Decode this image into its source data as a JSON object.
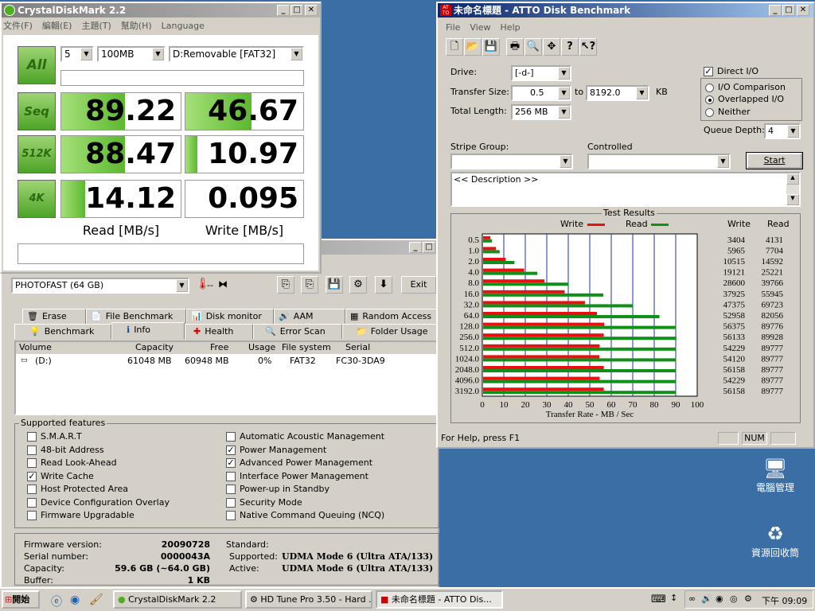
{
  "cdm": {
    "title": "CrystalDiskMark 2.2",
    "menu": [
      "文件(F)",
      "編輯(E)",
      "主題(T)",
      "幫助(H)",
      "Language"
    ],
    "count": "5",
    "size": "100MB",
    "drive": "D:Removable [FAT32]",
    "all_label": "All",
    "rows": [
      {
        "label": "Seq",
        "read": "89.22",
        "write": "46.67",
        "read_fill": 0.53,
        "write_fill": 0.56
      },
      {
        "label": "512K",
        "read": "88.47",
        "write": "10.97",
        "read_fill": 0.53,
        "write_fill": 0.1
      },
      {
        "label": "4K",
        "read": "14.12",
        "write": "0.095",
        "read_fill": 0.2,
        "write_fill": 0.0
      }
    ],
    "read_label": "Read [MB/s]",
    "write_label": "Write [MB/s]"
  },
  "hdtune": {
    "device": "PHOTOFAST (64 GB)",
    "temp": "-- ",
    "exit_label": "Exit",
    "tabs_top": [
      {
        "icon": "🗑",
        "label": "Erase"
      },
      {
        "icon": "📄",
        "label": "File Benchmark"
      },
      {
        "icon": "📊",
        "label": "Disk monitor"
      },
      {
        "icon": "🔊",
        "label": "AAM"
      },
      {
        "icon": "▦",
        "label": "Random Access"
      }
    ],
    "tabs_bottom": [
      {
        "icon": "💡",
        "label": "Benchmark"
      },
      {
        "icon": "ℹ",
        "label": "Info"
      },
      {
        "icon": "✚",
        "label": "Health"
      },
      {
        "icon": "🔍",
        "label": "Error Scan"
      },
      {
        "icon": "📁",
        "label": "Folder Usage"
      }
    ],
    "columns": [
      "Volume",
      "Capacity",
      "Free",
      "Usage",
      "File system",
      "Serial"
    ],
    "volume": {
      "name": "(D:)",
      "capacity": "61048 MB",
      "free": "60948 MB",
      "usage": "0%",
      "fs": "FAT32",
      "serial": "FC30-3DA9"
    },
    "features_label": "Supported features",
    "features_left": [
      {
        "label": "S.M.A.R.T",
        "checked": false
      },
      {
        "label": "48-bit Address",
        "checked": false
      },
      {
        "label": "Read Look-Ahead",
        "checked": false
      },
      {
        "label": "Write Cache",
        "checked": true
      },
      {
        "label": "Host Protected Area",
        "checked": false
      },
      {
        "label": "Device Configuration Overlay",
        "checked": false
      },
      {
        "label": "Firmware Upgradable",
        "checked": false
      }
    ],
    "features_right": [
      {
        "label": "Automatic Acoustic Management",
        "checked": false
      },
      {
        "label": "Power Management",
        "checked": true
      },
      {
        "label": "Advanced Power Management",
        "checked": true
      },
      {
        "label": "Interface Power Management",
        "checked": false
      },
      {
        "label": "Power-up in Standby",
        "checked": false
      },
      {
        "label": "Security Mode",
        "checked": false
      },
      {
        "label": "Native Command Queuing (NCQ)",
        "checked": false
      }
    ],
    "info": {
      "firmware_label": "Firmware version:",
      "firmware": "20090728",
      "serial_label": "Serial number:",
      "serial": "0000043A",
      "capacity_label": "Capacity:",
      "capacity": "59.6 GB (~64.0 GB)",
      "buffer_label": "Buffer:",
      "buffer": "1 KB",
      "standard_label": "Standard:",
      "supported_label": "Supported:",
      "supported": "UDMA Mode 6 (Ultra ATA/133)",
      "active_label": "Active:",
      "active": "UDMA Mode 6 (Ultra ATA/133)"
    }
  },
  "atto": {
    "title": "未命名標題 - ATTO Disk Benchmark",
    "menu": [
      "File",
      "View",
      "Help"
    ],
    "drive_label": "Drive:",
    "drive": "[-d-]",
    "transfer_label": "Transfer Size:",
    "transfer_from": "0.5",
    "to_label": "to",
    "transfer_to": "8192.0",
    "kb_label": "KB",
    "total_label": "Total Length:",
    "total": "256 MB",
    "direct_io": "Direct I/O",
    "radios": [
      {
        "label": "I/O Comparison",
        "on": false
      },
      {
        "label": "Overlapped I/O",
        "on": true
      },
      {
        "label": "Neither",
        "on": false
      }
    ],
    "queue_label": "Queue Depth:",
    "queue": "4",
    "stripe_label": "Stripe Group:",
    "controlled_label": "Controlled",
    "start_label": "Start",
    "description": "<< Description >>",
    "results_label": "Test Results",
    "write_label": "Write",
    "read_label": "Read",
    "status": "For Help, press F1",
    "num": "NUM",
    "colors": {
      "write": "#e81010",
      "read": "#109018"
    }
  },
  "chart_data": {
    "type": "bar",
    "title": "Test Results",
    "xlabel": "Transfer Rate - MB / Sec",
    "ylabel": "",
    "xlim": [
      0,
      100
    ],
    "xticks": [
      "0",
      "10",
      "20",
      "30",
      "40",
      "50",
      "60",
      "70",
      "80",
      "90",
      "100"
    ],
    "categories": [
      "0.5",
      "1.0",
      "2.0",
      "4.0",
      "8.0",
      "16.0",
      "32.0",
      "64.0",
      "128.0",
      "256.0",
      "512.0",
      "1024.0",
      "2048.0",
      "4096.0",
      "3192.0"
    ],
    "series": [
      {
        "name": "Write",
        "values": [
          3.404,
          5.965,
          10.515,
          19.121,
          28.6,
          37.925,
          47.375,
          52.958,
          56.375,
          56.133,
          54.229,
          54.12,
          56.158,
          54.229,
          56.158
        ],
        "labels": [
          "3404",
          "5965",
          "10515",
          "19121",
          "28600",
          "37925",
          "47375",
          "52958",
          "56375",
          "56133",
          "54229",
          "54120",
          "56158",
          "54229",
          "56158"
        ]
      },
      {
        "name": "Read",
        "values": [
          4.131,
          7.704,
          14.592,
          25.221,
          39.766,
          55.945,
          69.723,
          82.056,
          89.776,
          89.928,
          89.777,
          89.777,
          89.777,
          89.777,
          89.777
        ],
        "labels": [
          "4131",
          "7704",
          "14592",
          "25221",
          "39766",
          "55945",
          "69723",
          "82056",
          "89776",
          "89928",
          "89777",
          "89777",
          "89777",
          "89777",
          "89777"
        ]
      }
    ]
  },
  "desktop": {
    "icons": [
      {
        "label": "電腦管理"
      },
      {
        "label": "資源回收筒"
      }
    ]
  },
  "taskbar": {
    "start": "開始",
    "tasks": [
      "CrystalDiskMark 2.2",
      "HD Tune Pro 3.50 - Hard ...",
      "未命名標題 - ATTO Dis..."
    ],
    "clock": "下午 09:09"
  }
}
